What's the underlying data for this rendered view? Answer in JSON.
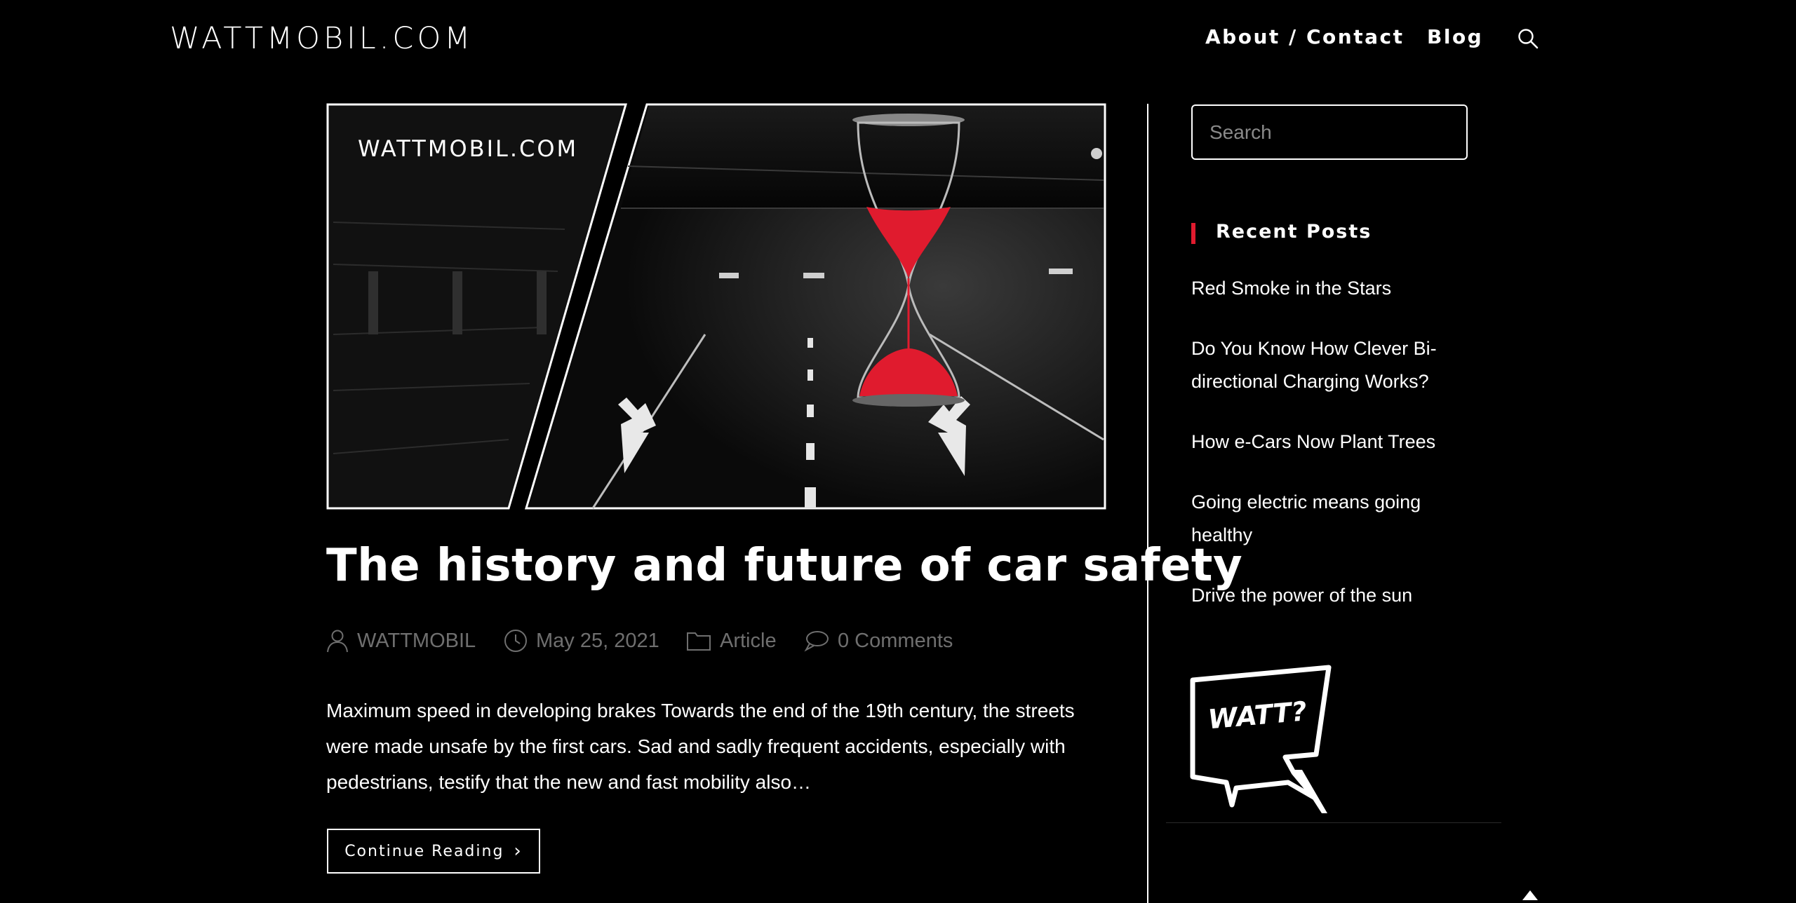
{
  "header": {
    "logo": "WATTMOBIL.COM",
    "nav": {
      "about": "About / Contact",
      "blog": "Blog"
    },
    "search_icon": "search-icon"
  },
  "post": {
    "image_logo": "WATTMOBIL.COM",
    "title": "The history and future of car safety",
    "meta": {
      "author": "WATTMOBIL",
      "date": "May 25, 2021",
      "category": "Article",
      "comments": "0 Comments"
    },
    "excerpt": "Maximum speed in developing brakes Towards the end of the 19th century, the streets were made unsafe by the first cars. Sad and sadly frequent accidents, especially with pedestrians, testify that the new and fast mobility also…",
    "continue_label": "Continue Reading"
  },
  "sidebar": {
    "search_placeholder": "Search",
    "recent_title": "Recent Posts",
    "recent_posts": [
      "Red Smoke in the Stars",
      "Do You Know How Clever Bi-directional Charging Works?",
      "How e-Cars Now Plant Trees",
      "Going electric means going healthy",
      "Drive the power of the sun"
    ],
    "watt_text": "WATT?"
  },
  "colors": {
    "accent": "#e01b2e",
    "background": "#000000",
    "text": "#ffffff",
    "meta": "#6f6f6f"
  }
}
